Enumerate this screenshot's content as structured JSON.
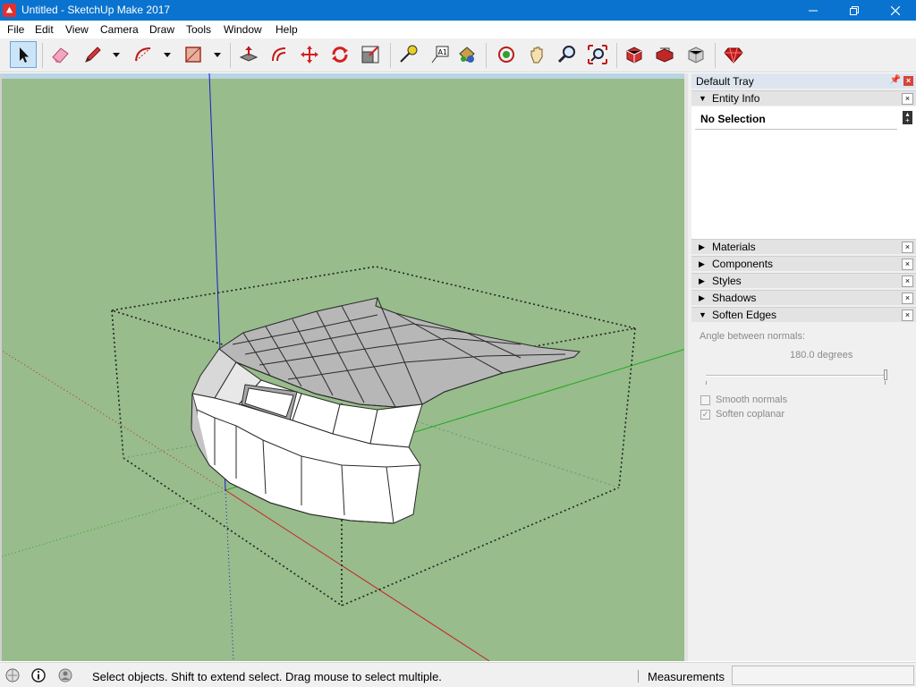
{
  "window": {
    "title": "Untitled - SketchUp Make 2017"
  },
  "menu": [
    "File",
    "Edit",
    "View",
    "Camera",
    "Draw",
    "Tools",
    "Window",
    "Help"
  ],
  "toolbar": {
    "tools": [
      "select-tool",
      "eraser-tool",
      "pencil-tool",
      "arc-tool",
      "rectangle-tool",
      "push-pull-tool",
      "offset-tool",
      "move-tool",
      "rotate-tool",
      "scale-tool",
      "tape-measure-tool",
      "text-tool",
      "paint-bucket-tool",
      "orbit-tool",
      "pan-tool",
      "zoom-tool",
      "zoom-extents-tool",
      "warehouse-tool",
      "share-model-tool",
      "extension-warehouse-tool",
      "ruby-console-tool"
    ]
  },
  "tray": {
    "title": "Default Tray",
    "entity_info": {
      "label": "Entity Info",
      "selection": "No Selection"
    },
    "panels": [
      "Materials",
      "Components",
      "Styles",
      "Shadows",
      "Soften Edges"
    ],
    "soften_edges": {
      "angle_label": "Angle between normals:",
      "angle_value": "180.0  degrees",
      "smooth_normals_label": "Smooth normals",
      "smooth_normals_checked": false,
      "soften_coplanar_label": "Soften coplanar",
      "soften_coplanar_checked": true
    }
  },
  "status": {
    "message": "Select objects. Shift to extend select. Drag mouse to select multiple.",
    "measurements_label": "Measurements",
    "measurements_value": ""
  },
  "colors": {
    "title_bar": "#0a73cf",
    "ground": "#98bc8c",
    "sky": "#b9d4e2",
    "axis_red": "#cc1f1f",
    "axis_green": "#1fa81f",
    "axis_blue": "#1a1ad0"
  }
}
